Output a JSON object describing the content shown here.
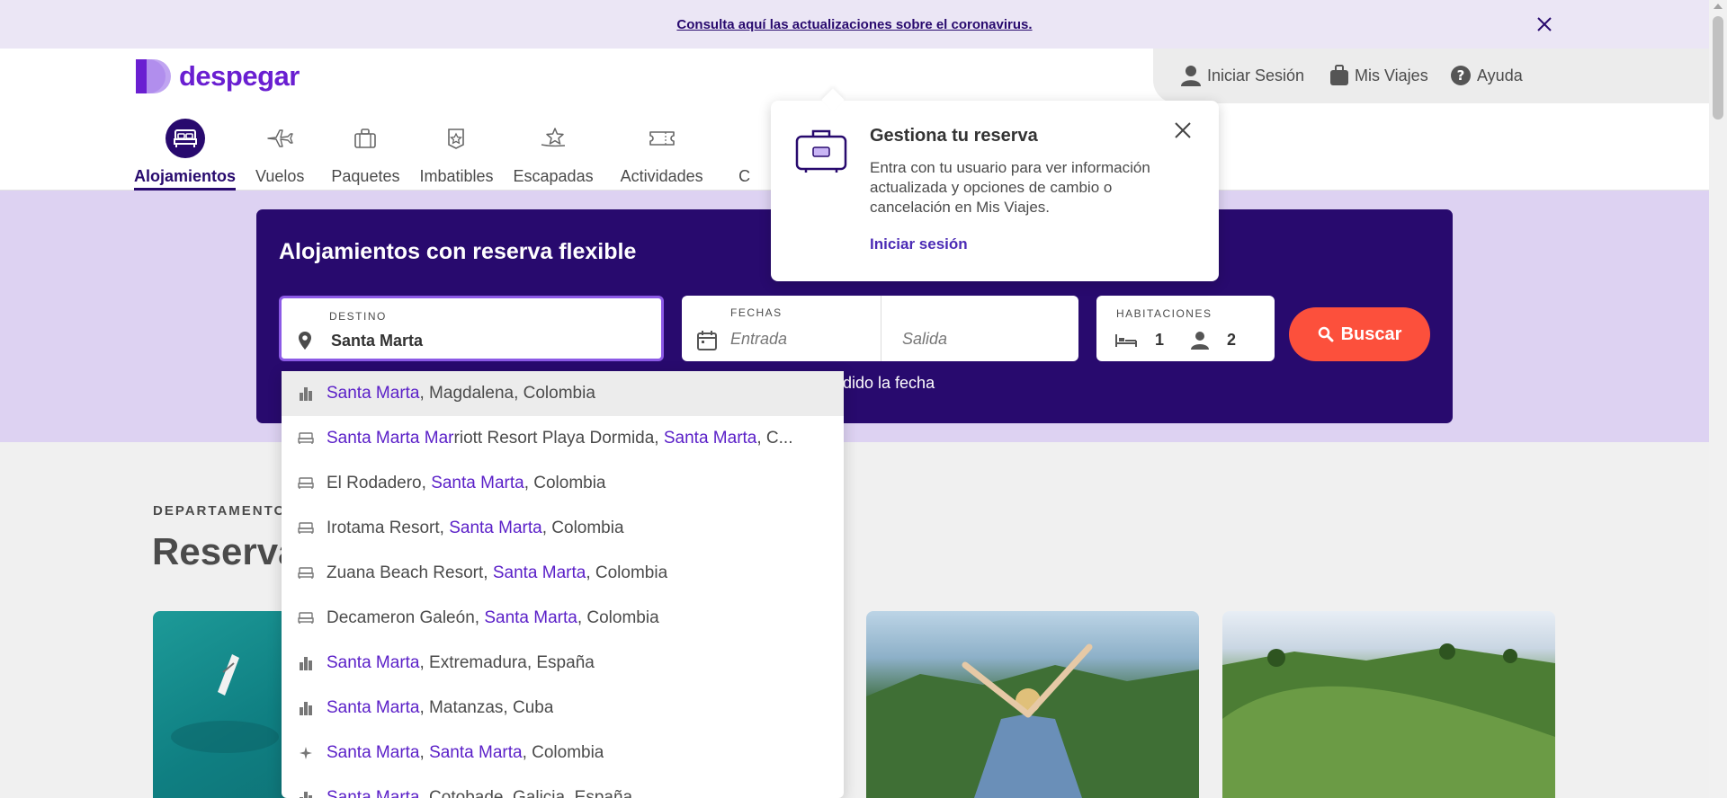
{
  "announcement": {
    "text": "Consulta aquí las actualizaciones sobre el coronavirus."
  },
  "brand": {
    "name": "despegar",
    "color": "#6a1fd1"
  },
  "account": {
    "login": "Iniciar Sesión",
    "trips": "Mis Viajes",
    "help": "Ayuda"
  },
  "nav": {
    "items": [
      {
        "label": "Alojamientos",
        "icon": "bed-icon",
        "active": true
      },
      {
        "label": "Vuelos",
        "icon": "plane-icon"
      },
      {
        "label": "Paquetes",
        "icon": "suitcase-icon"
      },
      {
        "label": "Imbatibles",
        "icon": "badge-star-icon"
      },
      {
        "label": "Escapadas",
        "icon": "star-swoosh-icon"
      },
      {
        "label": "Actividades",
        "icon": "ticket-icon"
      },
      {
        "label": "C",
        "icon": "partial-icon"
      }
    ]
  },
  "search": {
    "title": "Alojamientos con reserva flexible",
    "destination": {
      "label": "DESTINO",
      "value": "Santa Marta"
    },
    "dates": {
      "label": "FECHAS",
      "checkin_placeholder": "Entrada",
      "checkout_placeholder": "Salida"
    },
    "rooms": {
      "label": "HABITACIONES",
      "rooms": "1",
      "guests": "2"
    },
    "button": "Buscar",
    "flex_text_visible": "dido la fecha"
  },
  "popup": {
    "title": "Gestiona tu reserva",
    "body": "Entra con tu usuario para ver información actualizada y opciones de cambio o cancelación en Mis Viajes.",
    "link": "Iniciar sesión"
  },
  "section": {
    "kicker": "DEPARTAMENTOS",
    "title": "Reserva"
  },
  "autocomplete": [
    {
      "icon": "city-icon",
      "parts": [
        {
          "t": "Santa Marta",
          "m": true
        },
        {
          "t": ", Magdalena, Colombia"
        }
      ]
    },
    {
      "icon": "hotel-icon",
      "parts": [
        {
          "t": "Santa Marta",
          "m": true
        },
        {
          "t": " "
        },
        {
          "t": "Mar",
          "m": true
        },
        {
          "t": "riott Resort Playa Dormida, "
        },
        {
          "t": "Santa Marta",
          "m": true
        },
        {
          "t": ", C..."
        }
      ]
    },
    {
      "icon": "hotel-icon",
      "parts": [
        {
          "t": "El Rodadero, "
        },
        {
          "t": "Santa Marta",
          "m": true
        },
        {
          "t": ", Colombia"
        }
      ]
    },
    {
      "icon": "hotel-icon",
      "parts": [
        {
          "t": "Irotama Resort, "
        },
        {
          "t": "Santa Marta",
          "m": true
        },
        {
          "t": ", Colombia"
        }
      ]
    },
    {
      "icon": "hotel-icon",
      "parts": [
        {
          "t": "Zuana Beach Resort, "
        },
        {
          "t": "Santa Marta",
          "m": true
        },
        {
          "t": ", Colombia"
        }
      ]
    },
    {
      "icon": "hotel-icon",
      "parts": [
        {
          "t": "Decameron Galeón, "
        },
        {
          "t": "Santa Marta",
          "m": true
        },
        {
          "t": ", Colombia"
        }
      ]
    },
    {
      "icon": "city-icon",
      "parts": [
        {
          "t": "Santa Marta",
          "m": true
        },
        {
          "t": ", Extremadura, España"
        }
      ]
    },
    {
      "icon": "city-icon",
      "parts": [
        {
          "t": "Santa Marta",
          "m": true
        },
        {
          "t": ", Matanzas, Cuba"
        }
      ]
    },
    {
      "icon": "attraction-icon",
      "parts": [
        {
          "t": "Santa Marta",
          "m": true
        },
        {
          "t": ", "
        },
        {
          "t": "Santa Marta",
          "m": true
        },
        {
          "t": ", Colombia"
        }
      ]
    },
    {
      "icon": "city-icon",
      "parts": [
        {
          "t": "Santa Marta",
          "m": true
        },
        {
          "t": ", Cotobade, Galicia, España"
        }
      ]
    }
  ]
}
